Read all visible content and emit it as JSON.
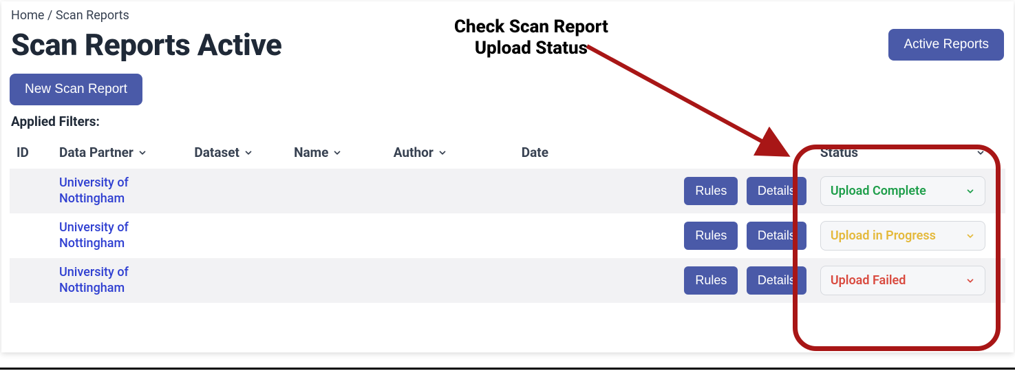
{
  "breadcrumb": {
    "home": "Home",
    "sep": "/",
    "current": "Scan Reports"
  },
  "page_title": "Scan Reports Active",
  "buttons": {
    "active_reports": "Active Reports",
    "new_scan_report": "New Scan Report",
    "rules": "Rules",
    "details": "Details"
  },
  "applied_filters_label": "Applied Filters:",
  "columns": {
    "id": "ID",
    "data_partner": "Data Partner",
    "dataset": "Dataset",
    "name": "Name",
    "author": "Author",
    "date": "Date",
    "status": "Status"
  },
  "rows": [
    {
      "data_partner": "University of Nottingham",
      "status": "Upload Complete",
      "status_kind": "complete"
    },
    {
      "data_partner": "University of Nottingham",
      "status": "Upload in Progress",
      "status_kind": "progress"
    },
    {
      "data_partner": "University of Nottingham",
      "status": "Upload Failed",
      "status_kind": "failed"
    }
  ],
  "annotation": {
    "line1": "Check Scan Report",
    "line2": "Upload Status"
  },
  "colors": {
    "primary": "#4a5aa8",
    "link": "#2f3fd1",
    "status_complete": "#1e9e4a",
    "status_progress": "#e4b93b",
    "status_failed": "#d94a3f",
    "annotation_red": "#a81616"
  }
}
